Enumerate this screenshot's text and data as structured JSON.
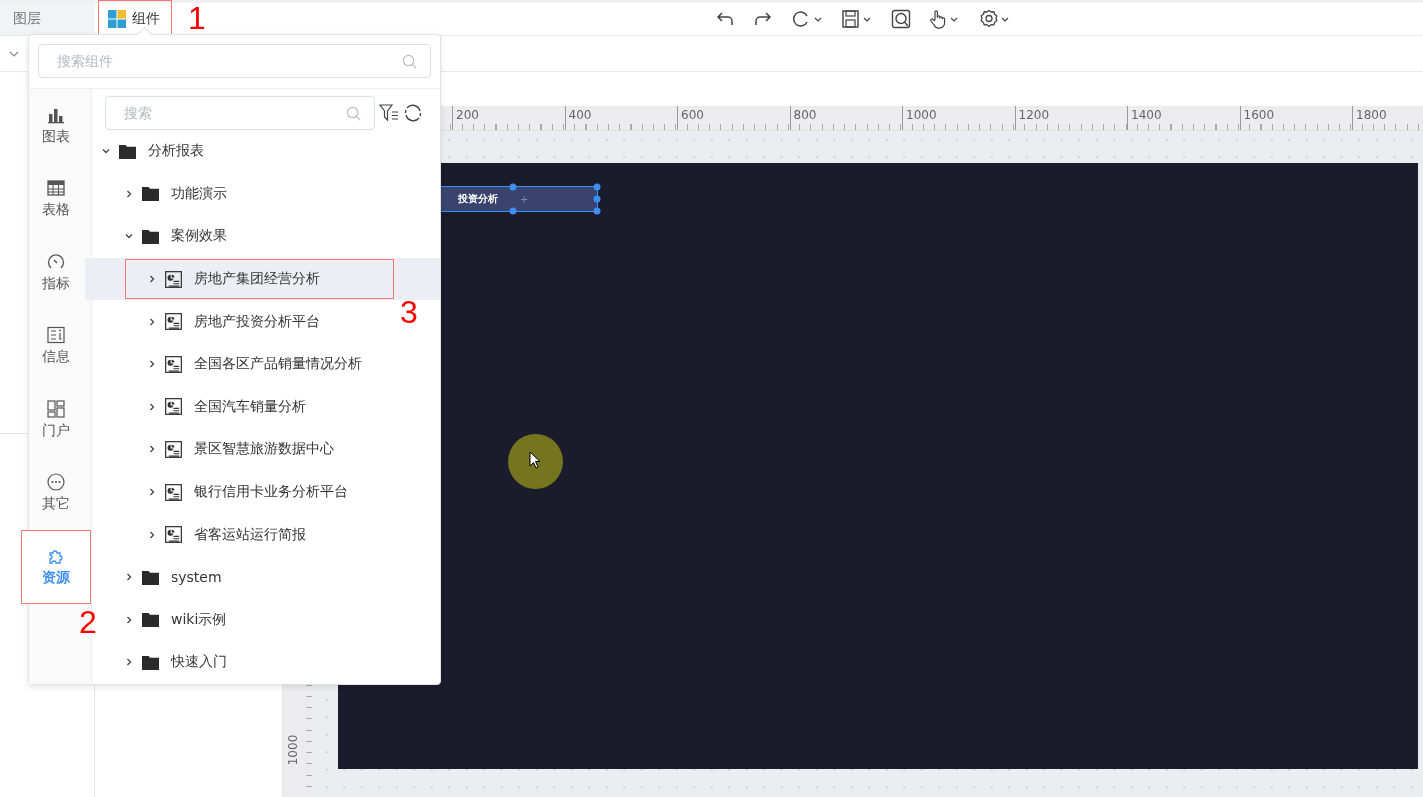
{
  "tabs": [
    {
      "label": "图层",
      "selected": false
    },
    {
      "label": "组件",
      "selected": true,
      "annotation": "1"
    }
  ],
  "component_search": {
    "placeholder": "搜索组件"
  },
  "categories": [
    {
      "label": "图表",
      "selected": false
    },
    {
      "label": "表格",
      "selected": false
    },
    {
      "label": "指标",
      "selected": false
    },
    {
      "label": "信息",
      "selected": false
    },
    {
      "label": "门户",
      "selected": false
    },
    {
      "label": "其它",
      "selected": false
    },
    {
      "label": "资源",
      "selected": true,
      "annotation": "2"
    }
  ],
  "tree_search": {
    "placeholder": "搜索"
  },
  "tree": [
    {
      "kind": "folder",
      "label": "分析报表",
      "expanded": true,
      "selected": false,
      "children": [
        {
          "kind": "folder",
          "label": "功能演示",
          "expanded": false,
          "selected": false
        },
        {
          "kind": "folder",
          "label": "案例效果",
          "expanded": true,
          "selected": false,
          "children": [
            {
              "kind": "report",
              "label": "房地产集团经营分析",
              "expanded": false,
              "selected": true,
              "annotation": "3"
            },
            {
              "kind": "report",
              "label": "房地产投资分析平台",
              "expanded": false,
              "selected": false
            },
            {
              "kind": "report",
              "label": "全国各区产品销量情况分析",
              "expanded": false,
              "selected": false
            },
            {
              "kind": "report",
              "label": "全国汽车销量分析",
              "expanded": false,
              "selected": false
            },
            {
              "kind": "report",
              "label": "景区智慧旅游数据中心",
              "expanded": false,
              "selected": false
            },
            {
              "kind": "report",
              "label": "银行信用卡业务分析平台",
              "expanded": false,
              "selected": false
            },
            {
              "kind": "report",
              "label": "省客运站运行简报",
              "expanded": false,
              "selected": false
            }
          ]
        },
        {
          "kind": "folder",
          "label": "system",
          "expanded": false,
          "selected": false
        },
        {
          "kind": "folder",
          "label": "wiki示例",
          "expanded": false,
          "selected": false
        },
        {
          "kind": "folder",
          "label": "快速入门",
          "expanded": false,
          "selected": false
        }
      ]
    }
  ],
  "ruler": {
    "x_labels": [
      "200",
      "400",
      "600",
      "800",
      "1000",
      "1200",
      "1400",
      "1600",
      "1800"
    ],
    "y_labels": [
      "1000"
    ]
  },
  "canvas": {
    "widget": {
      "label": "投资分析",
      "add": "+",
      "selected": true
    }
  }
}
